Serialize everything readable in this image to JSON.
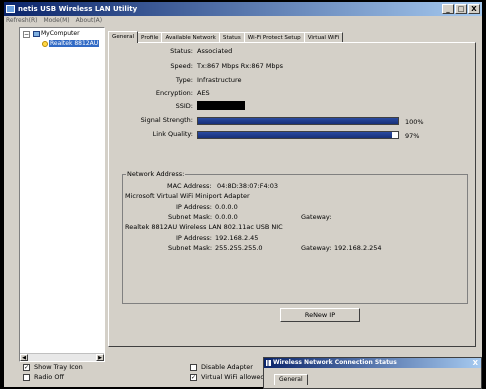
{
  "window": {
    "title": "netis USB Wireless LAN Utility",
    "minimize": "_",
    "maximize": "□",
    "close": "X"
  },
  "menu": [
    "Refresh(R)",
    "Mode(M)",
    "About(A)"
  ],
  "tree": {
    "expander": "−",
    "root": "MyComputer",
    "adapter": "Realtek 8812AU",
    "scroll_left": "◀",
    "scroll_right": "▶"
  },
  "tabs": [
    "General",
    "Profile",
    "Available Network",
    "Status",
    "Wi-Fi Protect Setup",
    "Virtual WiFi"
  ],
  "general": {
    "status_label": "Status:",
    "status": "Associated",
    "speed_label": "Speed:",
    "speed": "Tx:867 Mbps Rx:867 Mbps",
    "type_label": "Type:",
    "type": "Infrastructure",
    "encryption_label": "Encryption:",
    "encryption": "AES",
    "ssid_label": "SSID:",
    "signal_label": "Signal Strength:",
    "signal_pct": "100%",
    "signal_value": 1.0,
    "link_label": "Link Quality:",
    "link_pct": "97%",
    "link_value": 0.97
  },
  "network": {
    "group_title": "Network Address:",
    "mac_label": "MAC Address:",
    "mac": "04:8D:38:07:F4:03",
    "virtual_adapter": "Microsoft Virtual WiFi Miniport Adapter",
    "ip1_label": "IP Address:",
    "ip1": "0.0.0.0",
    "mask1_label": "Subnet Mask:",
    "mask1": "0.0.0.0",
    "gw1_label": "Gateway:",
    "gw1": "",
    "realtek_adapter": "Realtek 8812AU Wireless LAN 802.11ac USB NIC",
    "ip2_label": "IP Address:",
    "ip2": "192.168.2.45",
    "mask2_label": "Subnet Mask:",
    "mask2": "255.255.255.0",
    "gw2_label": "Gateway:",
    "gw2": "192.168.2.254"
  },
  "renew_label": "ReNew IP",
  "options": {
    "show_tray_icon": "Show Tray Icon",
    "radio_off": "Radio Off",
    "disable_adapter": "Disable Adapter",
    "virtual_wifi_allowed": "Virtual WiFi allowed",
    "checkmark": "✓"
  },
  "popup": {
    "title": "Wireless Network Connection Status",
    "close": "X",
    "tab": "General"
  }
}
